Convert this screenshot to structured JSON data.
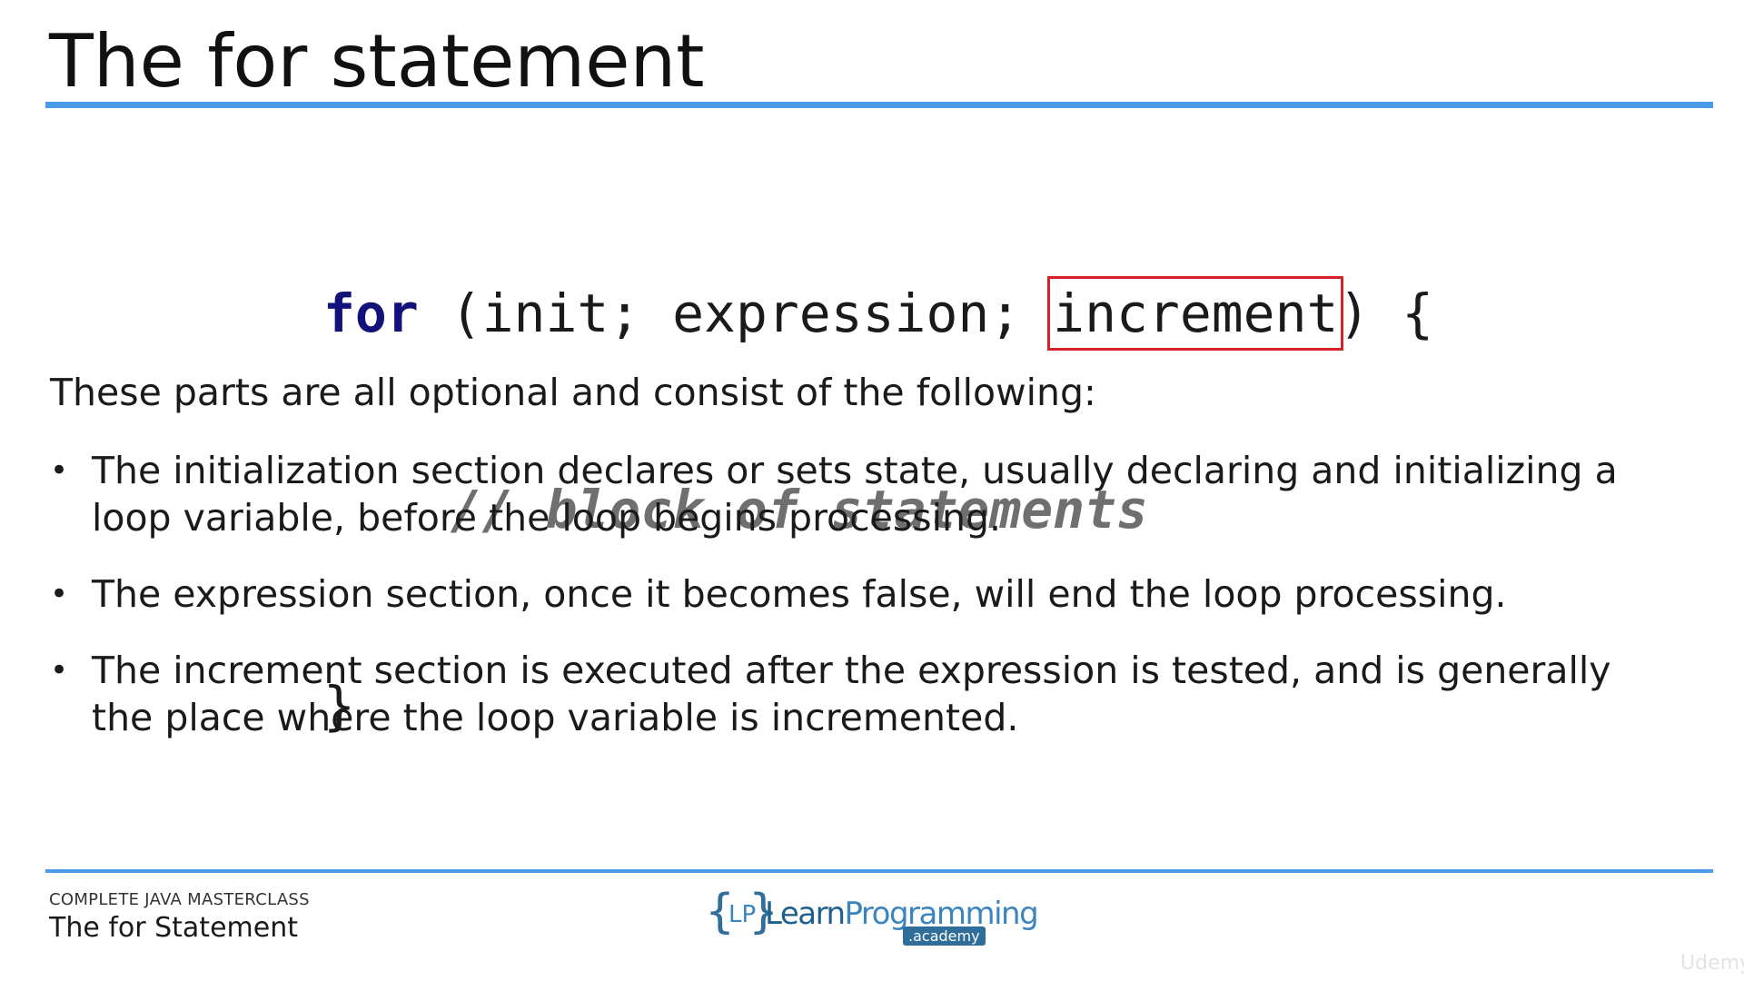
{
  "slide": {
    "title": "The for statement",
    "code": {
      "line1": {
        "keyword": "for",
        "open": " (init; expression; ",
        "highlighted": "increment",
        "close": ") {"
      },
      "line2": {
        "indent": "    ",
        "comment": "// block of statements"
      },
      "line3": "}"
    },
    "intro": "These parts are all optional and consist of the following:",
    "bullets": [
      {
        "marker": "•",
        "text": "The initialization section declares or sets state, usually declaring and initializing a loop variable, before the loop begins processing."
      },
      {
        "marker": "•",
        "text": "The expression section, once it becomes false, will end the loop processing."
      },
      {
        "marker": "•",
        "text": "The increment section is executed after the expression is tested, and is generally the place where the loop variable is incremented."
      }
    ]
  },
  "footer": {
    "course": "COMPLETE JAVA MASTERCLASS",
    "lecture": "The for Statement",
    "logo": {
      "brace_open": "{",
      "lp": "LP",
      "brace_close": "}",
      "word1": "Learn",
      "word2": "Programming",
      "academy": ".academy"
    }
  },
  "watermark": "Udemy",
  "colors": {
    "accent_rule": "#4c9be8",
    "keyword": "#12127a",
    "highlight_box": "#d42027",
    "comment": "#6f6f6f"
  }
}
